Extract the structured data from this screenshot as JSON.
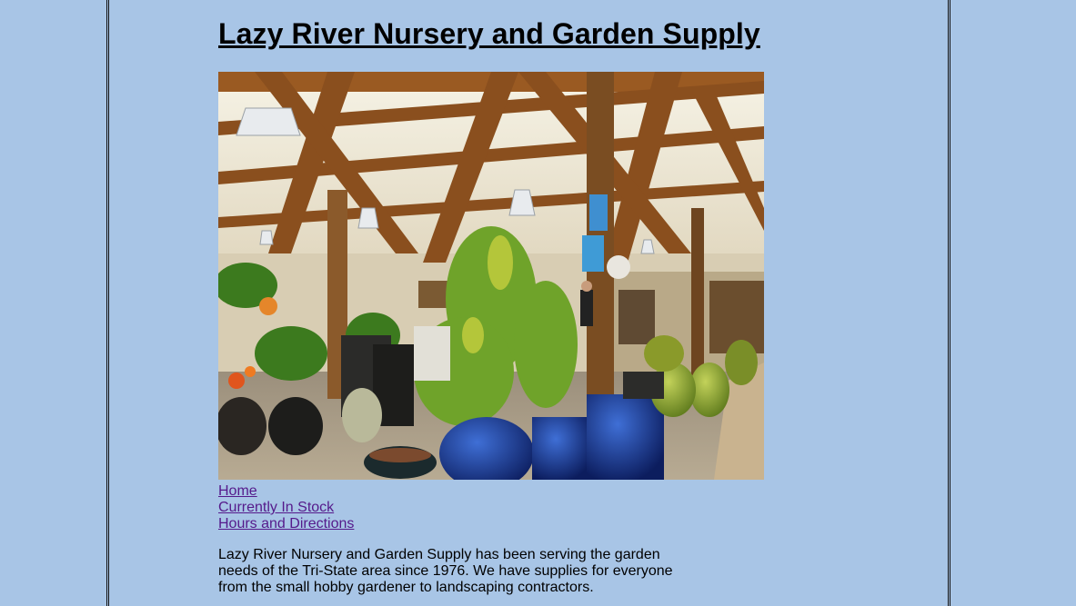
{
  "site": {
    "title": "Lazy River Nursery and Garden Supply"
  },
  "photo": {
    "subject": "garden center interior with wooden beams, hanging lamps, plants and glazed ceramic pots"
  },
  "nav": {
    "items": [
      {
        "label": "Home"
      },
      {
        "label": "Currently In Stock"
      },
      {
        "label": "Hours and Directions"
      }
    ]
  },
  "intro": {
    "text": "Lazy River Nursery and Garden Supply has been serving the garden needs of the Tri-State area since 1976. We have supplies for everyone from the small hobby gardener to landscaping contractors."
  },
  "colors": {
    "background": "#a8c5e6",
    "visited_link": "#551a8b",
    "border": "#111111"
  }
}
